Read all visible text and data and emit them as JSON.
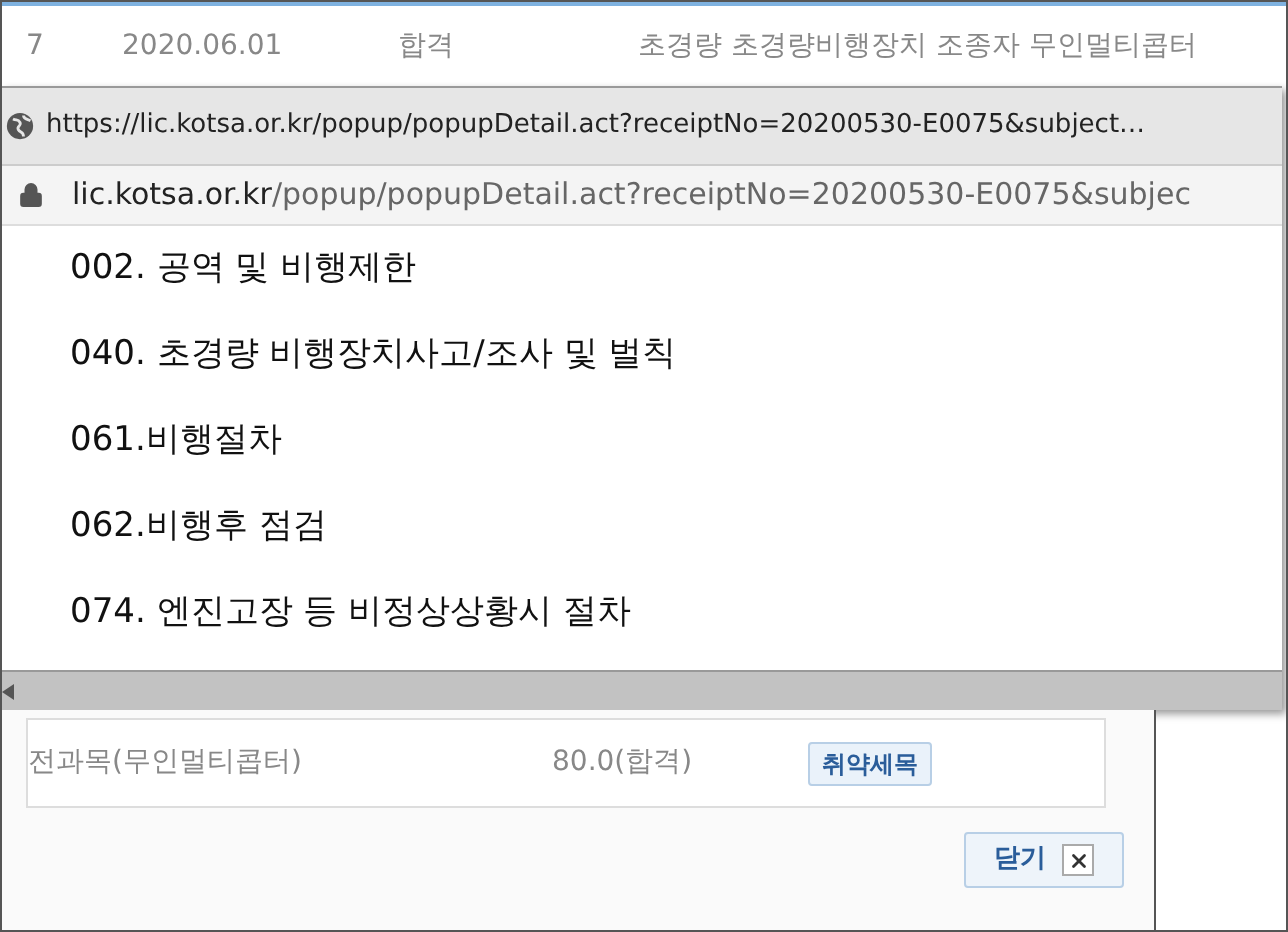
{
  "background_row": {
    "no": "7",
    "date": "2020.06.01",
    "result": "합격",
    "subject": "초경량 초경량비행장치 조종자 무인멀티콥터"
  },
  "popup": {
    "title_url": "https://lic.kotsa.or.kr/popup/popupDetail.act?receiptNo=20200530-E0075&subject…",
    "address": {
      "domain": "lic.kotsa.or.kr",
      "path": "/popup/popupDetail.act?receiptNo=20200530-E0075&subjec"
    },
    "items": [
      "002. 공역 및 비행제한",
      "040. 초경량 비행장치사고/조사 및 벌칙",
      "061.비행절차",
      "062.비행후 점검",
      "074. 엔진고장 등 비정상상황시 절차"
    ]
  },
  "result_row": {
    "subject": "전과목(무인멀티콥터)",
    "score": "80.0(합격)",
    "button": "취약세목"
  },
  "close_button": "닫기"
}
